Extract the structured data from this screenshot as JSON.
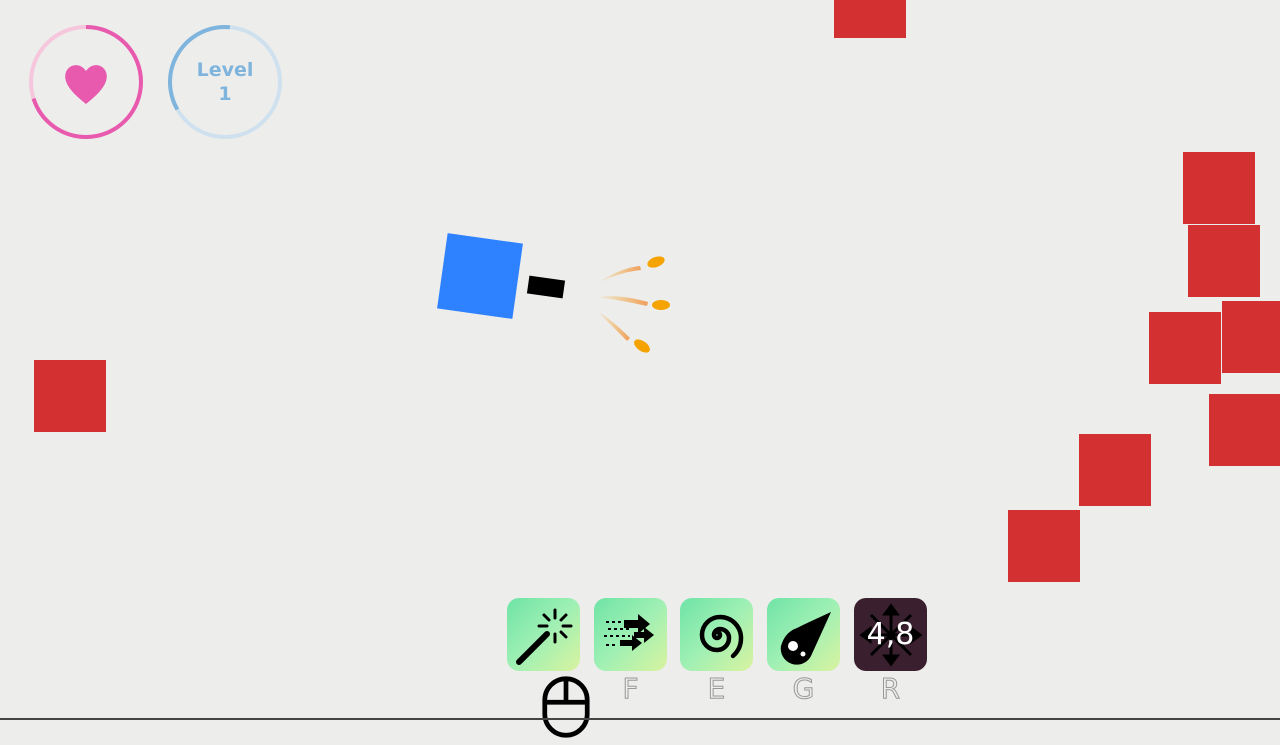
{
  "hud": {
    "health": {
      "icon": "heart-icon",
      "fraction": 0.7,
      "color": "#e85aae",
      "track_color": "#f5c6dc"
    },
    "level": {
      "label": "Level",
      "value": "1",
      "color": "#7fb4dd",
      "track_color": "#cfe1ee"
    }
  },
  "player": {
    "color": "#2f82ff",
    "gun_color": "#000000"
  },
  "projectiles": {
    "color": "#f5a300",
    "count": 3
  },
  "enemies": {
    "color": "#d33131",
    "count": 11
  },
  "abilities": [
    {
      "icon": "magic-wand-icon",
      "key": "",
      "key_icon": "mouse-icon",
      "ready": true
    },
    {
      "icon": "dash-arrows-icon",
      "key": "F",
      "ready": true
    },
    {
      "icon": "spiral-icon",
      "key": "E",
      "ready": true
    },
    {
      "icon": "meteor-icon",
      "key": "G",
      "ready": true
    },
    {
      "icon": "expand-arrows-icon",
      "key": "R",
      "ready": false,
      "cooldown": "4,8"
    }
  ]
}
